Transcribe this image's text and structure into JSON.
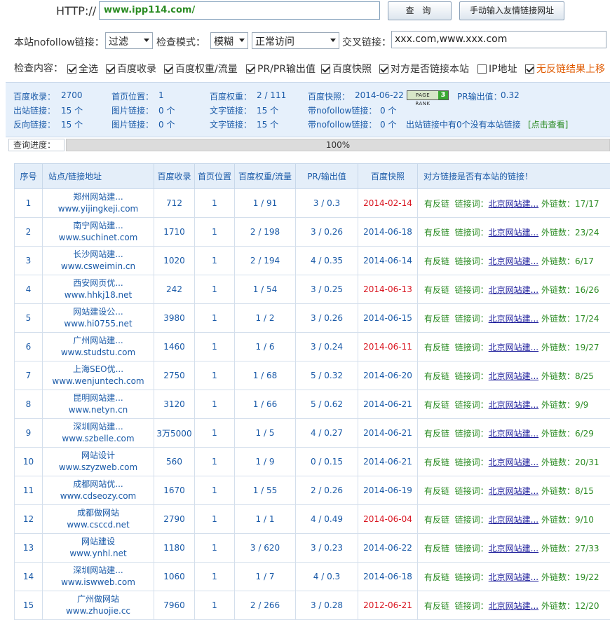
{
  "url_bar": {
    "label": "HTTP://",
    "value": "www.ipp114.com/",
    "query_button": "查 询",
    "manual_button": "手动输入友情链接网址"
  },
  "options": {
    "nofollow_label": "本站nofollow链接：",
    "nofollow_value": "过滤",
    "mode_label": "检查模式：",
    "mode_value": "模糊",
    "access_value": "正常访问",
    "cross_label": "交叉链接：",
    "cross_value": "xxx.com,www.xxx.com"
  },
  "check_content": {
    "label": "检查内容：",
    "items": [
      {
        "label": "全选",
        "checked": true
      },
      {
        "label": "百度收录",
        "checked": true
      },
      {
        "label": "百度权重/流量",
        "checked": true
      },
      {
        "label": "PR/PR输出值",
        "checked": true
      },
      {
        "label": "百度快照",
        "checked": true
      },
      {
        "label": "对方是否链接本站",
        "checked": true
      },
      {
        "label": "IP地址",
        "checked": false
      },
      {
        "label": "无反链结果上移",
        "checked": true
      }
    ]
  },
  "summary": {
    "baidu_index_label": "百度收录：",
    "baidu_index": "2700",
    "home_pos_label": "首页位置：",
    "home_pos": "1",
    "baidu_weight_label": "百度权重：",
    "baidu_weight": "2 / 111",
    "snapshot_label": "百度快照：",
    "snapshot": "2014-06-22",
    "pagerank_text": "PAGE RANK",
    "pagerank_value": "3",
    "pr_out_label": "PR输出值：",
    "pr_out": "0.32",
    "out_links_label": "出站链接：",
    "out_links": "15 个",
    "img_links_label": "图片链接：",
    "img_links": "0 个",
    "text_links_label": "文字链接：",
    "text_links": "15 个",
    "nofollow_links_label": "带nofollow链接：",
    "nofollow_links": "0 个",
    "back_links_label": "反向链接：",
    "back_links": "15 个",
    "img_links2_label": "图片链接：",
    "img_links2": "0 个",
    "text_links2_label": "文字链接：",
    "text_links2": "15 个",
    "nofollow_links2_label": "带nofollow链接：",
    "nofollow_links2": "0 个",
    "no_backlink_note": "出站链接中有0个没有本站链接",
    "view_link": "[点击查看]"
  },
  "progress": {
    "label": "查询进度：",
    "percent": 100,
    "text": "100%"
  },
  "table": {
    "headers": [
      "序号",
      "站点/链接地址",
      "百度收录",
      "首页位置",
      "百度权重/流量",
      "PR/输出值",
      "百度快照",
      "对方链接是否有本站的链接！"
    ],
    "backlink_text": "有反链",
    "keyword_label": "链接词：",
    "keyword": "北京网站建...",
    "outlinks_label": "外链数：",
    "rows": [
      {
        "no": "1",
        "name": "郑州网站建...",
        "domain": "www.yijingkeji.com",
        "index": "712",
        "pos": "1",
        "weight": "1 / 91",
        "pr": "3 / 0.3",
        "snapshot": "2014-02-14",
        "old": true,
        "outlinks": "17/17"
      },
      {
        "no": "2",
        "name": "南宁网站建...",
        "domain": "www.suchinet.com",
        "index": "1710",
        "pos": "1",
        "weight": "2 / 198",
        "pr": "3 / 0.26",
        "snapshot": "2014-06-18",
        "old": false,
        "outlinks": "23/24"
      },
      {
        "no": "3",
        "name": "长沙网站建...",
        "domain": "www.csweimin.cn",
        "index": "1020",
        "pos": "1",
        "weight": "2 / 194",
        "pr": "4 / 0.35",
        "snapshot": "2014-06-14",
        "old": false,
        "outlinks": "6/17"
      },
      {
        "no": "4",
        "name": "西安网页优...",
        "domain": "www.hhkj18.net",
        "index": "242",
        "pos": "1",
        "weight": "1 / 54",
        "pr": "3 / 0.25",
        "snapshot": "2014-06-13",
        "old": true,
        "outlinks": "16/26"
      },
      {
        "no": "5",
        "name": "网站建设公...",
        "domain": "www.hi0755.net",
        "index": "3980",
        "pos": "1",
        "weight": "1 / 2",
        "pr": "3 / 0.26",
        "snapshot": "2014-06-15",
        "old": false,
        "outlinks": "17/24"
      },
      {
        "no": "6",
        "name": "广州网站建...",
        "domain": "www.studstu.com",
        "index": "1460",
        "pos": "1",
        "weight": "1 / 6",
        "pr": "3 / 0.24",
        "snapshot": "2014-06-11",
        "old": true,
        "outlinks": "19/27"
      },
      {
        "no": "7",
        "name": "上海SEO优...",
        "domain": "www.wenjuntech.com",
        "index": "2750",
        "pos": "1",
        "weight": "1 / 68",
        "pr": "5 / 0.32",
        "snapshot": "2014-06-20",
        "old": false,
        "outlinks": "8/25"
      },
      {
        "no": "8",
        "name": "昆明网站建...",
        "domain": "www.netyn.cn",
        "index": "3120",
        "pos": "1",
        "weight": "1 / 66",
        "pr": "5 / 0.62",
        "snapshot": "2014-06-21",
        "old": false,
        "outlinks": "9/9"
      },
      {
        "no": "9",
        "name": "深圳网站建...",
        "domain": "www.szbelle.com",
        "index": "3万5000",
        "pos": "1",
        "weight": "1 / 5",
        "pr": "4 / 0.27",
        "snapshot": "2014-06-21",
        "old": false,
        "outlinks": "6/29"
      },
      {
        "no": "10",
        "name": "网站设计",
        "domain": "www.szyzweb.com",
        "index": "560",
        "pos": "1",
        "weight": "1 / 9",
        "pr": "0 / 0.15",
        "snapshot": "2014-06-21",
        "old": false,
        "outlinks": "20/31"
      },
      {
        "no": "11",
        "name": "成都网站优...",
        "domain": "www.cdseozy.com",
        "index": "1670",
        "pos": "1",
        "weight": "1 / 55",
        "pr": "2 / 0.26",
        "snapshot": "2014-06-19",
        "old": false,
        "outlinks": "8/15"
      },
      {
        "no": "12",
        "name": "成都做网站",
        "domain": "www.csccd.net",
        "index": "2790",
        "pos": "1",
        "weight": "1 / 1",
        "pr": "4 / 0.49",
        "snapshot": "2014-06-04",
        "old": true,
        "outlinks": "9/10"
      },
      {
        "no": "13",
        "name": "网站建设",
        "domain": "www.ynhl.net",
        "index": "1180",
        "pos": "1",
        "weight": "3 / 620",
        "pr": "3 / 0.23",
        "snapshot": "2014-06-22",
        "old": false,
        "outlinks": "27/33"
      },
      {
        "no": "14",
        "name": "深圳网站建...",
        "domain": "www.iswweb.com",
        "index": "1060",
        "pos": "1",
        "weight": "1 / 7",
        "pr": "4 / 0.3",
        "snapshot": "2014-06-18",
        "old": false,
        "outlinks": "19/22"
      },
      {
        "no": "15",
        "name": "广州做网站",
        "domain": "www.zhuojie.cc",
        "index": "7960",
        "pos": "1",
        "weight": "2 / 266",
        "pr": "3 / 0.28",
        "snapshot": "2012-06-21",
        "old": true,
        "outlinks": "12/20"
      }
    ]
  }
}
